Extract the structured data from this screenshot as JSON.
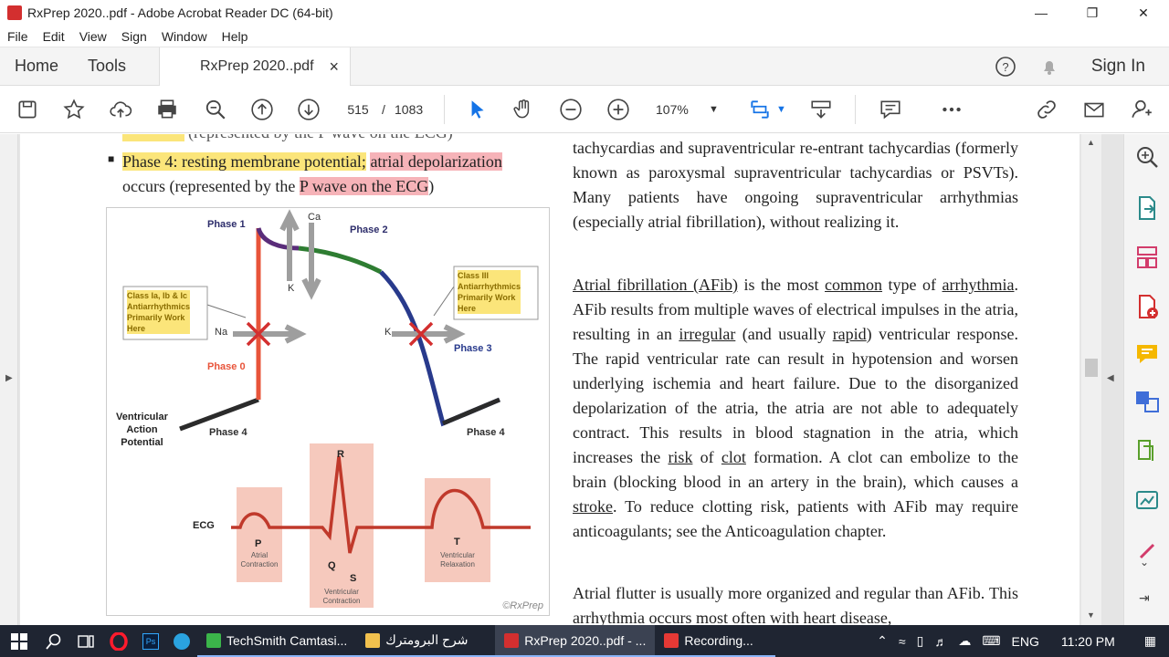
{
  "window": {
    "title": "RxPrep 2020..pdf - Adobe Acrobat Reader DC (64-bit)"
  },
  "menu": [
    "File",
    "Edit",
    "View",
    "Sign",
    "Window",
    "Help"
  ],
  "tabs": {
    "home": "Home",
    "tools": "Tools",
    "doc": "RxPrep 2020..pdf",
    "close": "×"
  },
  "header": {
    "signin": "Sign In"
  },
  "toolbar": {
    "page_current": "515",
    "page_sep": "/",
    "page_total": "1083",
    "zoom": "107%"
  },
  "document": {
    "cut_line": "(represented by the P wave on the ECG)",
    "bullet": {
      "phase": "Phase 4: resting membrane potential;",
      "atrial": "atrial depolarization",
      "occurs": "occurs (represented by the",
      "pwave": "P wave on the ECG",
      "close": ")"
    },
    "para1": "tachycardias and supraventricular re-entrant tachycardias (formerly known as paroxysmal supraventricular tachycardias or PSVTs). Many patients have ongoing supraventricular arrhythmias (especially atrial fibrillation), without realizing it.",
    "para2": {
      "w1": "Atrial fibrillation (AFib)",
      "w2": " is the most ",
      "w3": "common",
      "w4": " type of ",
      "w5": "arrhythmia",
      "w6": ". AFib results from multiple waves of electrical impulses in the atria, resulting in an ",
      "w7": "irregular",
      "w8": " (and usually ",
      "w9": "rapid",
      "w10": ") ventricular response. The rapid ventricular rate can result in hypotension and worsen underlying ischemia and heart failure. Due to the disorganized depolarization of the atria, the atria are not able to adequately contract. This results in blood stagnation in the atria, which increases the ",
      "w11": "risk",
      "w12": " of ",
      "w13": "clot",
      "w14": " formation. A clot can embolize to the brain (blocking blood in an artery in the brain), which causes a ",
      "w15": "stroke",
      "w16": ". To reduce clotting risk, patients with AFib may require anticoagulants; see the Anticoagulation chapter."
    },
    "para3": "Atrial flutter is usually more organized and regular than AFib. This arrhythmia occurs most often with heart disease,"
  },
  "figure": {
    "phase1": "Phase 1",
    "phase2": "Phase 2",
    "phase0": "Phase 0",
    "phase3": "Phase 3",
    "phase4a": "Phase 4",
    "phase4b": "Phase 4",
    "ca": "Ca",
    "k1": "K",
    "na": "Na",
    "k2": "K",
    "class1_l1": "Class Ia, Ib & Ic",
    "class1_l2": "Antiarrhythmics",
    "class1_l3": "Primarily Work",
    "class1_l4": "Here",
    "class3_l1": "Class III",
    "class3_l2": "Antiarrhythmics",
    "class3_l3": "Primarily Work",
    "class3_l4": "Here",
    "vap_l1": "Ventricular",
    "vap_l2": "Action",
    "vap_l3": "Potential",
    "ecg": "ECG",
    "r": "R",
    "p": "P",
    "q": "Q",
    "s": "S",
    "t": "T",
    "atrial_l1": "Atrial",
    "atrial_l2": "Contraction",
    "vcont_l1": "Ventricular",
    "vcont_l2": "Contraction",
    "vrel_l1": "Ventricular",
    "vrel_l2": "Relaxation",
    "copyright": "©RxPrep"
  },
  "taskbar": {
    "apps": [
      {
        "label": "TechSmith Camtasi...",
        "color": "#3bb54a"
      },
      {
        "label": "شرح البرومترك",
        "color": "#f2c14e"
      },
      {
        "label": "RxPrep 2020..pdf - ...",
        "color": "#d32f2f"
      },
      {
        "label": "Recording...",
        "color": "#e53935"
      }
    ],
    "lang": "ENG",
    "time": "11:20 PM"
  }
}
